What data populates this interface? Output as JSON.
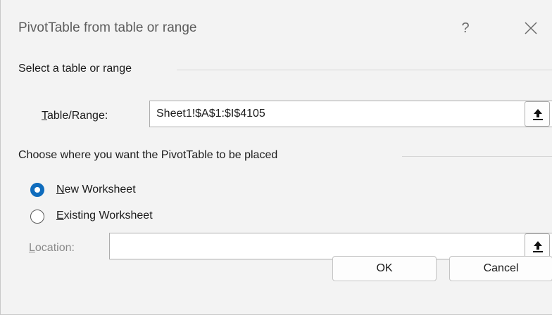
{
  "window": {
    "title": "PivotTable from table or range",
    "help_label": "?"
  },
  "source": {
    "section_label": "Select a table or range",
    "field_label_mnemonic": "T",
    "field_label_rest": "able/Range:",
    "value": "Sheet1!$A$1:$I$4105"
  },
  "placement": {
    "section_label": "Choose where you want the PivotTable to be placed",
    "options": [
      {
        "mnemonic": "N",
        "rest": "ew Worksheet",
        "selected": true
      },
      {
        "mnemonic": "E",
        "rest": "xisting Worksheet",
        "selected": false
      }
    ],
    "location_label_mnemonic": "L",
    "location_label_rest": "ocation:",
    "location_value": ""
  },
  "buttons": {
    "ok_label": "OK",
    "cancel_label": "Cancel"
  },
  "icons": {
    "close": "close-icon",
    "collapse": "collapse-dialog-icon"
  }
}
